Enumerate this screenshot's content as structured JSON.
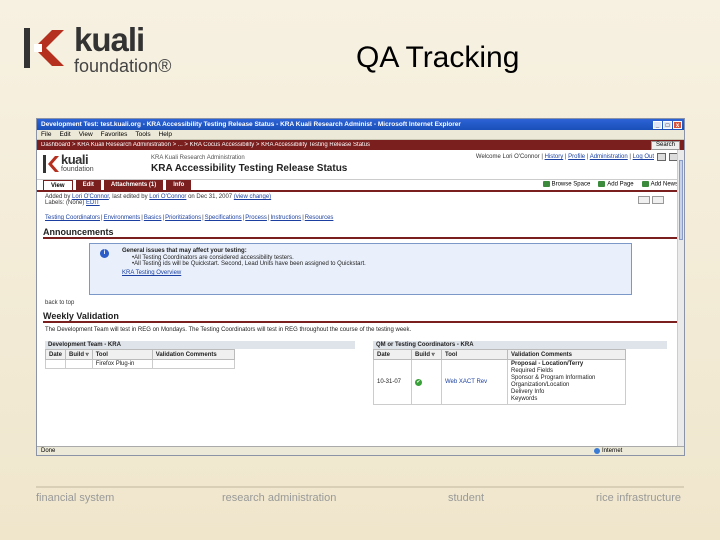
{
  "slide": {
    "title": "QA Tracking",
    "logo": {
      "word": "kuali",
      "sub": "foundation®"
    },
    "footer": [
      "financial system",
      "research administration",
      "student",
      "rice infrastructure"
    ]
  },
  "browser": {
    "window_title": "Development Test: test.kuali.org - KRA Accessibility Testing Release Status - KRA Kuali Research Administ - Microsoft Internet Explorer",
    "window_buttons": [
      "_",
      "□",
      "x"
    ],
    "menu": [
      "File",
      "Edit",
      "View",
      "Favorites",
      "Tools",
      "Help"
    ],
    "status_text": "Done",
    "status_zone": "Internet"
  },
  "kuali": {
    "breadcrumb": "Dashboard > KRA Kuali Research Administration > ... > KRA Cocus Accessibility > KRA Accessibility Testing Release Status",
    "search_label": "Search",
    "logo_word": "kuali",
    "logo_sub": "foundation",
    "subtitle": "KRA Kuali Research Administration",
    "page_title": "KRA Accessibility Testing Release Status",
    "user": {
      "welcome": "Welcome Lori O'Connor",
      "history": "History",
      "profile": "Profile",
      "administration": "Administration",
      "logout": "Log Out"
    },
    "tabs": [
      "View",
      "Edit",
      "Attachments (1)",
      "Info"
    ],
    "actions": [
      "Browse Space",
      "Add Page",
      "Add News"
    ],
    "meta": {
      "line1_prefix": "Added by",
      "added_by": "Lori O'Connor",
      "line1_mid": ", last edited by",
      "edited_by": "Lori O'Connor",
      "line1_suffix": "on Dec 31, 2007",
      "view_change": "(view change)",
      "labels_prefix": "Labels: (None)",
      "edit_label": "EDIT"
    },
    "nav_links": [
      "Testing Coordinators",
      "Environments",
      "Basics",
      "Prioritizations",
      "Specifications",
      "Process",
      "Instructions",
      "Resources"
    ],
    "announcements": {
      "heading": "Announcements",
      "box_head": "General issues that may affect your testing:",
      "items": [
        "All Testing Coordinators are considered accessibility testers.",
        "All Testing ids will be Quickstart. Second, Lead Units have been assigned to Quickstart."
      ],
      "link": "KRA Testing Overview"
    },
    "back_to_top": "back to top",
    "weekly": {
      "heading": "Weekly Validation",
      "intro": "The Development Team will test in REG on Mondays. The Testing Coordinators will test in REG throughout the course of the testing week.",
      "dev_table": {
        "title": "Development Team - KRA",
        "headers": [
          "Date",
          "Build ▿",
          "Tool",
          "Validation Comments"
        ],
        "rows": [
          [
            "",
            "",
            "Firefox Plug-in",
            ""
          ]
        ]
      },
      "qm_table": {
        "title": "QM or Testing Coordinators - KRA",
        "headers": [
          "Date",
          "Build ▿",
          "Tool",
          "Validation Comments"
        ],
        "rows": [
          {
            "date": "10-31-07",
            "build": "✔",
            "tool": "Web XACT Rev",
            "comments": [
              "Proposal - Location/Terry",
              "Required Fields",
              "Sponsor & Program Information",
              "Organization/Location",
              "Delivery Info",
              "Keywords"
            ]
          }
        ]
      }
    }
  }
}
